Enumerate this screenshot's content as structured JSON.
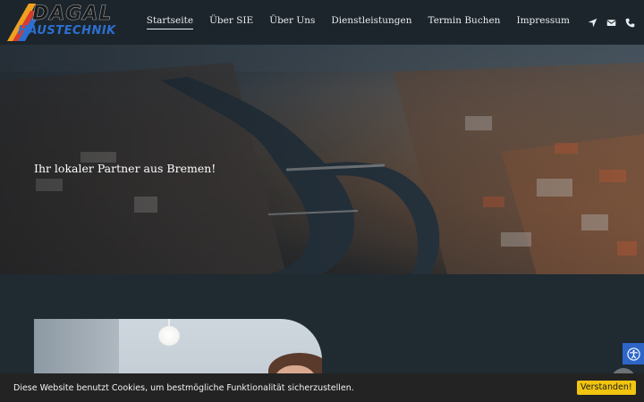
{
  "brand": {
    "logo_top": "DAGAL",
    "logo_bottom": "HAUSTECHNIK"
  },
  "nav": {
    "items": [
      {
        "label": "Startseite",
        "active": true
      },
      {
        "label": "Über SIE",
        "active": false
      },
      {
        "label": "Über Uns",
        "active": false
      },
      {
        "label": "Dienstleistungen",
        "active": false
      },
      {
        "label": "Termin Buchen",
        "active": false
      },
      {
        "label": "Impressum",
        "active": false
      }
    ],
    "icons": [
      "location-arrow-icon",
      "envelope-icon",
      "phone-icon"
    ]
  },
  "hero": {
    "tagline": "Ihr lokaler Partner aus Bremen!"
  },
  "cookie": {
    "text": "Diese Website benutzt Cookies, um bestmögliche Funktionalität sicherzustellen.",
    "button_label": "Verstanden!"
  },
  "colors": {
    "header_bg": "#1c252b",
    "page_bg": "#1f2a31",
    "accent_blue": "#2e66c8",
    "button_yellow": "#f1c40f"
  }
}
